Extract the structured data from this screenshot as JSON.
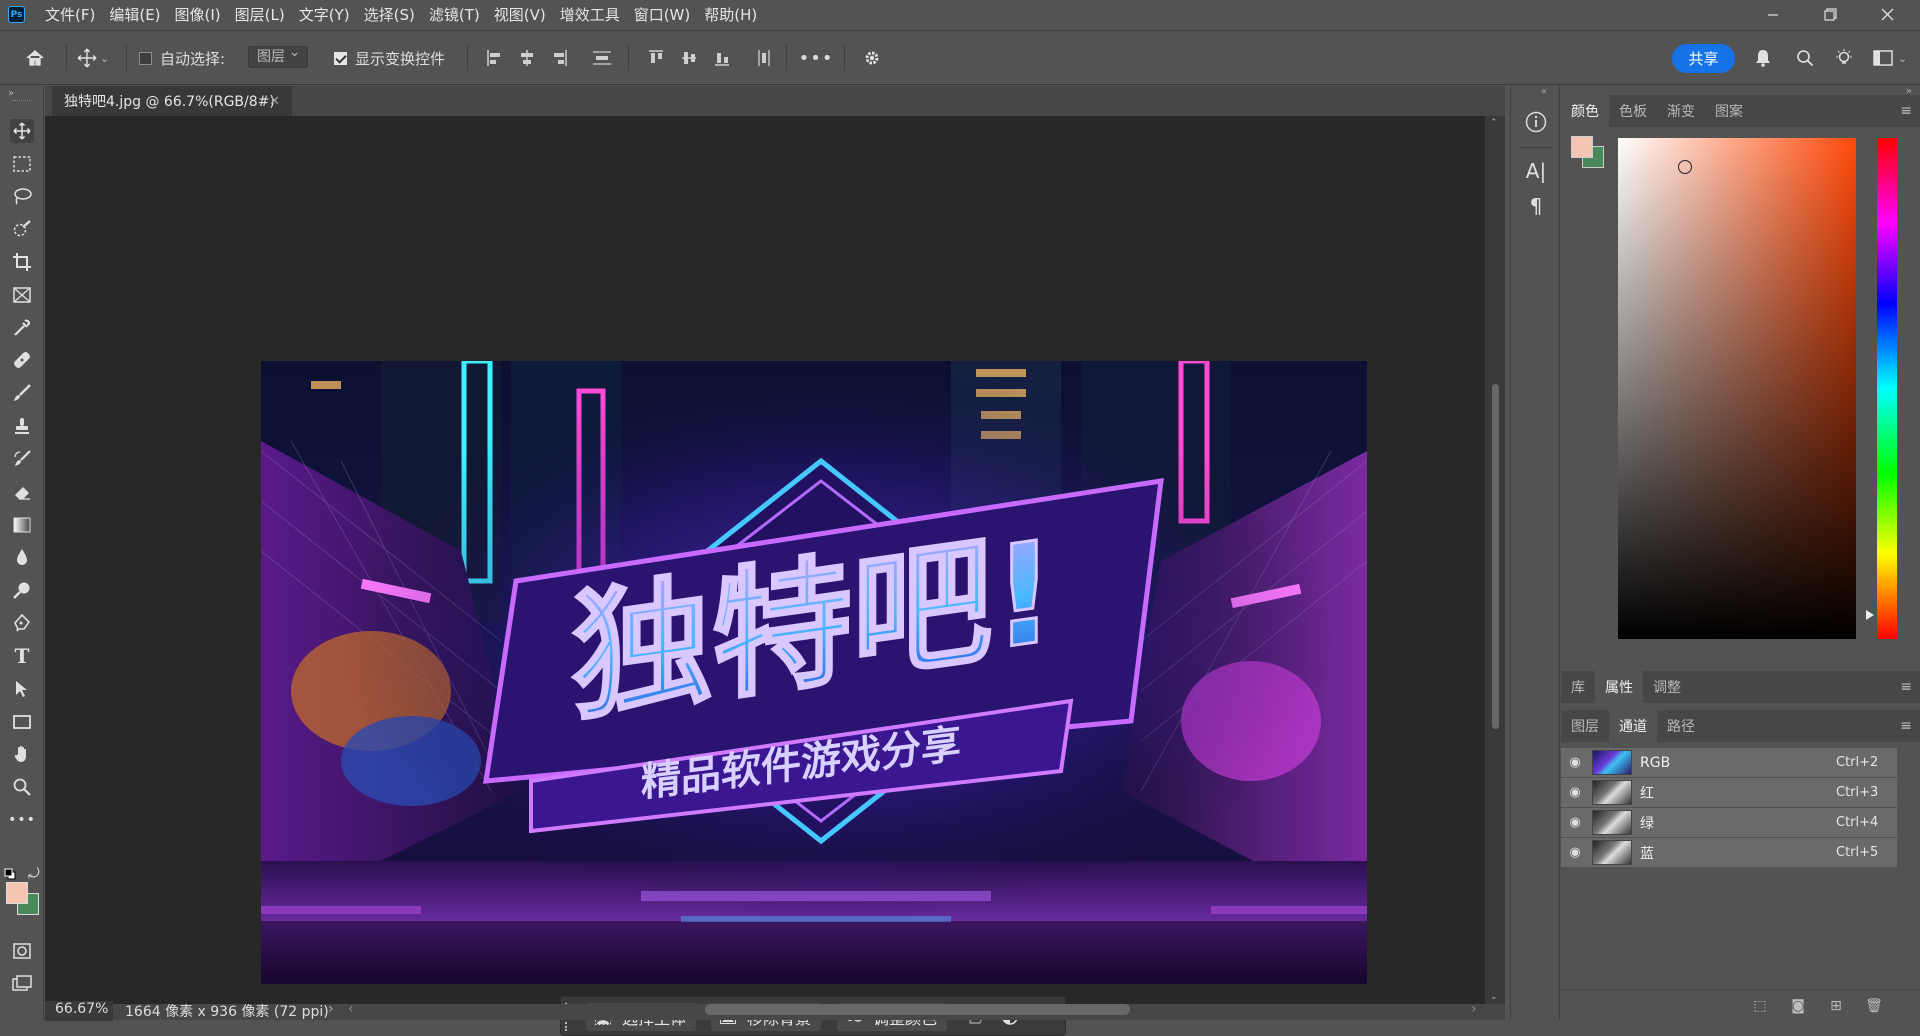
{
  "app": {
    "logo_text": "Ps",
    "menu": [
      "文件(F)",
      "编辑(E)",
      "图像(I)",
      "图层(L)",
      "文字(Y)",
      "选择(S)",
      "滤镜(T)",
      "视图(V)",
      "增效工具",
      "窗口(W)",
      "帮助(H)"
    ]
  },
  "options": {
    "auto_select_label": "自动选择:",
    "auto_select_checked": false,
    "auto_select_target": "图层",
    "show_transform_label": "显示变换控件",
    "show_transform_checked": true,
    "share_label": "共享"
  },
  "document": {
    "tab_title": "独特吧4.jpg @ 66.7%(RGB/8#)",
    "artwork_title": "独特吧!",
    "artwork_subtitle": "精品软件游戏分享"
  },
  "status": {
    "zoom": "66.67%",
    "doc_info": "1664 像素 x 936 像素 (72 ppi)"
  },
  "taskbar": {
    "select_subject": "选择主体",
    "remove_background": "移除背景",
    "adjust_color": "调整颜色"
  },
  "color_panel": {
    "tabs": [
      "颜色",
      "色板",
      "渐变",
      "图案"
    ],
    "active_tab": "颜色",
    "foreground": "#f4c5b3",
    "background": "#4a8a5a",
    "hue_field_color": "#ff4a0a"
  },
  "properties_panel": {
    "tabs": [
      "库",
      "属性",
      "调整"
    ],
    "active_tab": "属性"
  },
  "layers_panel": {
    "tabs": [
      "图层",
      "通道",
      "路径"
    ],
    "active_tab": "通道",
    "channels": [
      {
        "name": "RGB",
        "shortcut": "Ctrl+2"
      },
      {
        "name": "红",
        "shortcut": "Ctrl+3"
      },
      {
        "name": "绿",
        "shortcut": "Ctrl+4"
      },
      {
        "name": "蓝",
        "shortcut": "Ctrl+5"
      }
    ]
  }
}
